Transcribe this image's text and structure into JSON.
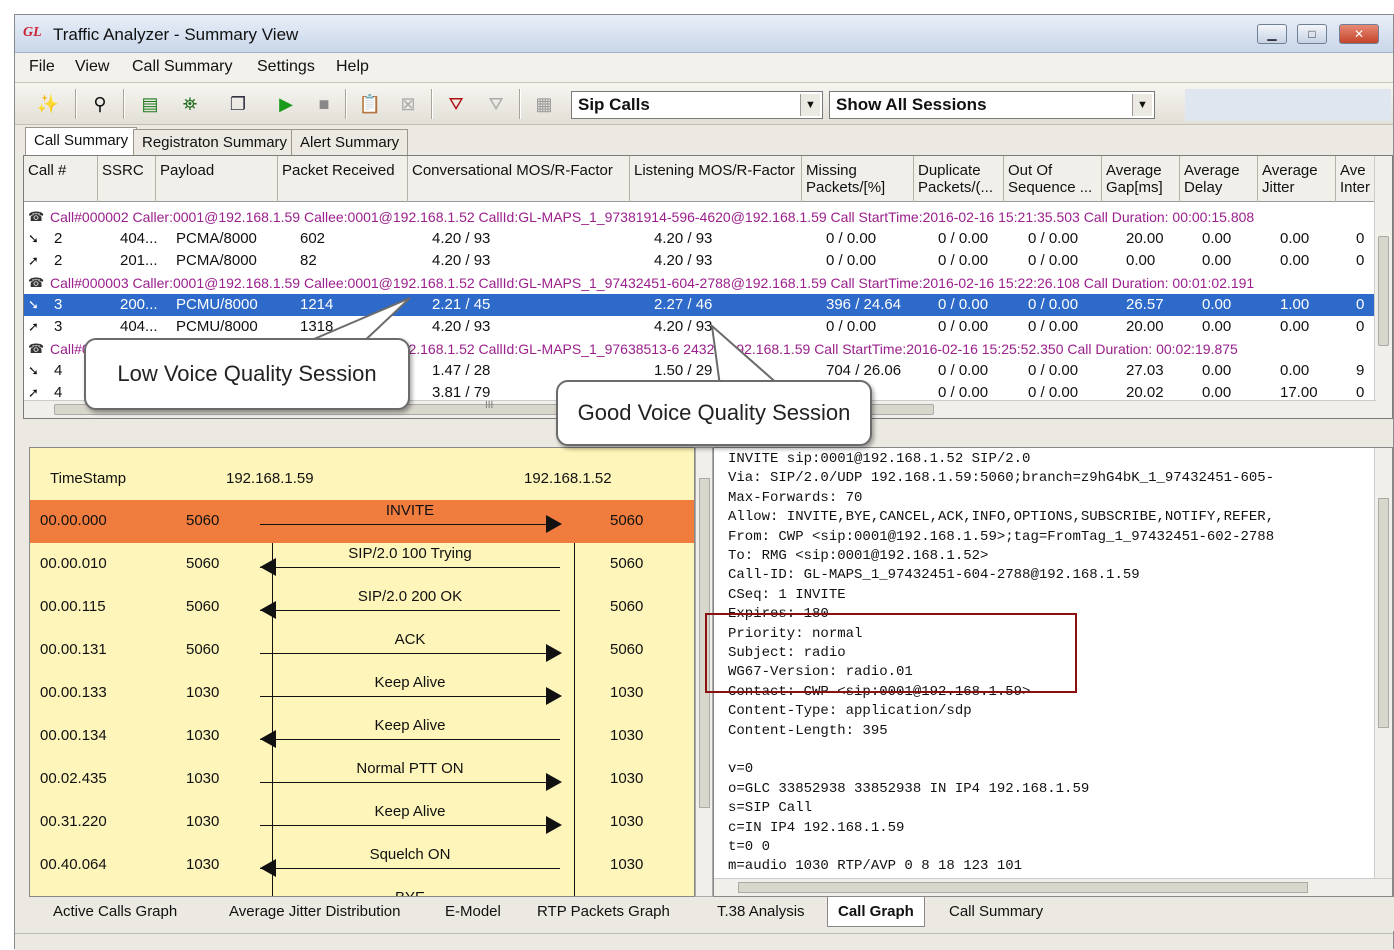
{
  "window": {
    "app_icon": "ᵔ",
    "title": "Traffic Analyzer - Summary View"
  },
  "menu": [
    "File",
    "View",
    "Call Summary",
    "Settings",
    "Help"
  ],
  "toolbar": {
    "combo_calls": "Sip Calls",
    "combo_sessions": "Show All Sessions"
  },
  "top_tabs": [
    "Call Summary",
    "Registraton Summary",
    "Alert Summary"
  ],
  "grid": {
    "headers": [
      "Call #",
      "SSRC",
      "Payload",
      "Packet Received",
      "Conversational MOS/R-Factor",
      "Listening MOS/R-Factor",
      "Missing Packets/[%]",
      "Duplicate Packets/(...",
      "Out Of Sequence ...",
      "Average Gap[ms]",
      "Average Delay",
      "Average Jitter",
      "Ave Inter"
    ],
    "call_rows": [
      "Call#000002  Caller:0001@192.168.1.59 Callee:0001@192.168.1.52 CallId:GL-MAPS_1_97381914-596-4620@192.168.1.59 Call StartTime:2016-02-16 15:21:35.503 Call Duration: 00:00:15.808",
      "Call#000003  Caller:0001@192.168.1.59 Callee:0001@192.168.1.52 CallId:GL-MAPS_1_97432451-604-2788@192.168.1.59 Call StartTime:2016-02-16 15:22:26.108 Call Duration: 00:01:02.191",
      "Call#000004  Caller:0001@192.168.1.59 Callee:0001@192.168.1.52 CallId:GL-MAPS_1_97638513-6  2432@192.168.1.59 Call StartTime:2016-02-16 15:25:52.350 Call Duration: 00:02:19.875"
    ],
    "stream_rows": [
      [
        "2",
        "404...",
        "PCMA/8000",
        "602",
        "4.20 / 93",
        "4.20 / 93",
        "0 / 0.00",
        "0 / 0.00",
        "0 / 0.00",
        "20.00",
        "0.00",
        "0.00",
        "0"
      ],
      [
        "2",
        "201...",
        "PCMA/8000",
        "82",
        "4.20 / 93",
        "4.20 / 93",
        "0 / 0.00",
        "0 / 0.00",
        "0 / 0.00",
        "0.00",
        "0.00",
        "0.00",
        "0"
      ],
      [
        "3",
        "200...",
        "PCMU/8000",
        "1214",
        "2.21 / 45",
        "2.27 / 46",
        "396 / 24.64",
        "0 / 0.00",
        "0 / 0.00",
        "26.57",
        "0.00",
        "1.00",
        "0"
      ],
      [
        "3",
        "404...",
        "PCMU/8000",
        "1318",
        "4.20 / 93",
        "4.20 / 93",
        "0 / 0.00",
        "0 / 0.00",
        "0 / 0.00",
        "20.00",
        "0.00",
        "0.00",
        "0"
      ],
      [
        "4",
        "",
        "",
        "",
        "1.47 / 28",
        "1.50 / 29",
        "704 / 26.06",
        "0 / 0.00",
        "0 / 0.00",
        "27.03",
        "0.00",
        "0.00",
        "9"
      ],
      [
        "4",
        "",
        "",
        "",
        "3.81 / 79",
        "",
        "",
        "0 / 0.00",
        "0 / 0.00",
        "20.02",
        "0.00",
        "17.00",
        "0"
      ]
    ],
    "scroll_marker": "III"
  },
  "callouts": {
    "low": "Low Voice Quality  Session",
    "good": "Good Voice Quality  Session"
  },
  "ladder": {
    "col_timestamp": "TimeStamp",
    "ip_a": "192.168.1.59",
    "ip_b": "192.168.1.52",
    "rows": [
      {
        "ts": "00.00.000",
        "pa": "5060",
        "pb": "5060",
        "msg": "INVITE",
        "dir": "right"
      },
      {
        "ts": "00.00.010",
        "pa": "5060",
        "pb": "5060",
        "msg": "SIP/2.0 100 Trying",
        "dir": "left"
      },
      {
        "ts": "00.00.115",
        "pa": "5060",
        "pb": "5060",
        "msg": "SIP/2.0 200 OK",
        "dir": "left"
      },
      {
        "ts": "00.00.131",
        "pa": "5060",
        "pb": "5060",
        "msg": "ACK",
        "dir": "right"
      },
      {
        "ts": "00.00.133",
        "pa": "1030",
        "pb": "1030",
        "msg": "Keep Alive",
        "dir": "right"
      },
      {
        "ts": "00.00.134",
        "pa": "1030",
        "pb": "1030",
        "msg": "Keep Alive",
        "dir": "left"
      },
      {
        "ts": "00.02.435",
        "pa": "1030",
        "pb": "1030",
        "msg": "Normal PTT ON",
        "dir": "right"
      },
      {
        "ts": "00.31.220",
        "pa": "1030",
        "pb": "1030",
        "msg": "Keep Alive",
        "dir": "right"
      },
      {
        "ts": "00.40.064",
        "pa": "1030",
        "pb": "1030",
        "msg": "Squelch ON",
        "dir": "left"
      },
      {
        "ts": "",
        "pa": "",
        "pb": "",
        "msg": "BYE",
        "dir": "right"
      }
    ]
  },
  "packet_lines": [
    "INVITE sip:0001@192.168.1.52 SIP/2.0",
    "Via: SIP/2.0/UDP 192.168.1.59:5060;branch=z9hG4bK_1_97432451-605-",
    "Max-Forwards: 70",
    "Allow: INVITE,BYE,CANCEL,ACK,INFO,OPTIONS,SUBSCRIBE,NOTIFY,REFER,",
    "From: CWP <sip:0001@192.168.1.59>;tag=FromTag_1_97432451-602-2788",
    "To: RMG <sip:0001@192.168.1.52>",
    "Call-ID: GL-MAPS_1_97432451-604-2788@192.168.1.59",
    "CSeq: 1 INVITE",
    "Expires: 180",
    "Priority: normal",
    "Subject: radio",
    "WG67-Version: radio.01",
    "Contact: CWP <sip:0001@192.168.1.59>",
    "Content-Type: application/sdp",
    "Content-Length: 395",
    "",
    "v=0",
    "o=GLC 33852938 33852938 IN IP4 192.168.1.59",
    "s=SIP Call",
    "c=IN IP4 192.168.1.59",
    "t=0 0",
    "m=audio 1030 RTP/AVP 0 8 18 123 101"
  ],
  "bottom_tabs": [
    "Active Calls Graph",
    "Average Jitter Distribution",
    "E-Model",
    "RTP Packets Graph",
    "T.38 Analysis",
    "Call Graph",
    "Call Summary"
  ],
  "active_bottom_tab": "Call Graph"
}
